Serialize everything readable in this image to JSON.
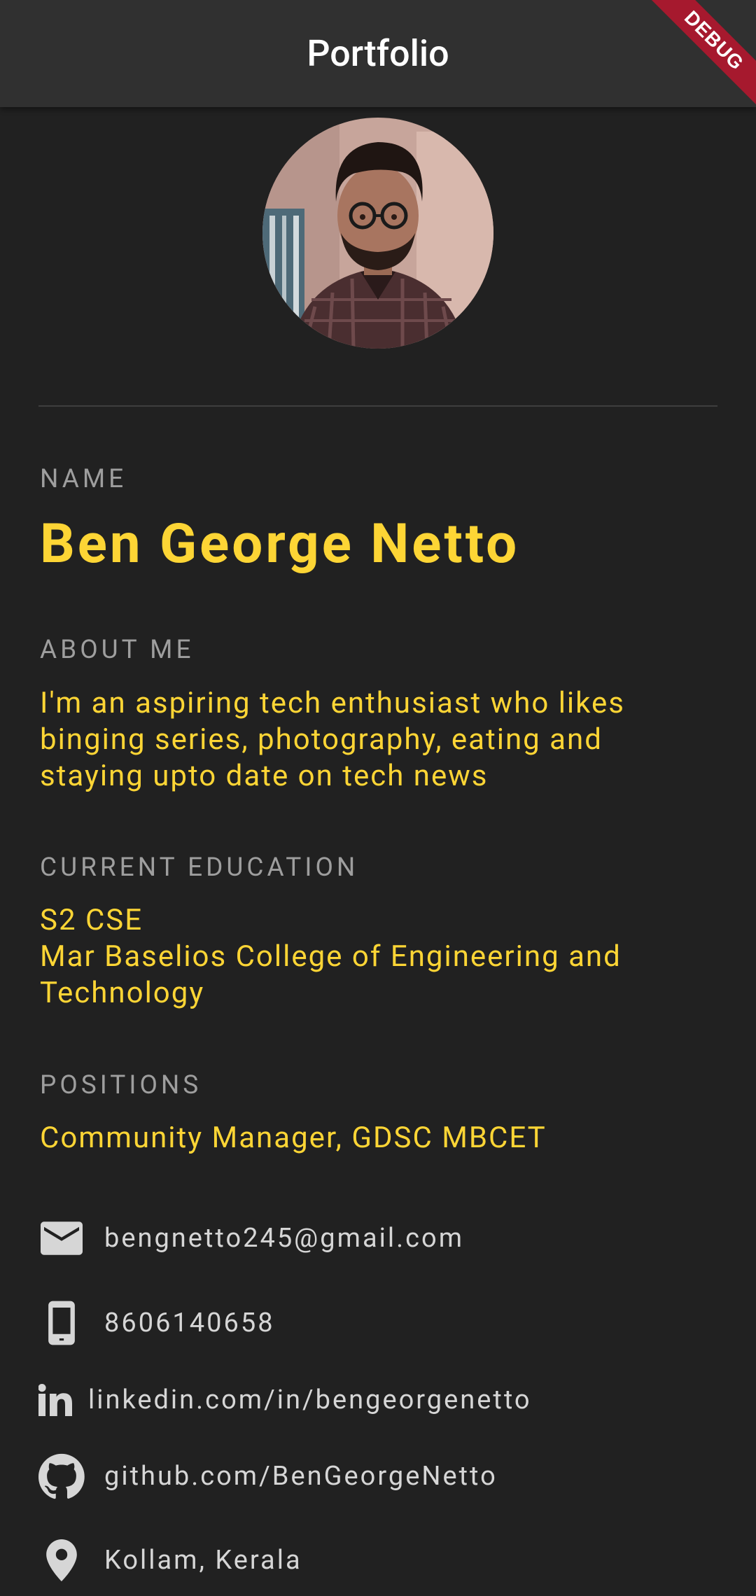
{
  "appbar": {
    "title": "Portfolio",
    "debug_label": "DEBUG"
  },
  "colors": {
    "background": "#212121",
    "appbar": "#303030",
    "accent": "#fdd535",
    "label": "#9e9e9e",
    "contact_text": "#d6d6d6",
    "debug": "#a6192e"
  },
  "profile": {
    "name_label": "NAME",
    "name": "Ben George Netto",
    "about_label": "ABOUT ME",
    "about_lines": [
      "I'm an aspiring tech enthusiast who likes",
      "binging series, photography, eating and",
      "staying upto date on tech news"
    ],
    "education_label": "CURRENT EDUCATION",
    "education_lines": [
      "S2 CSE",
      "Mar Baselios College of Engineering and",
      "Technology"
    ],
    "positions_label": "POSITIONS",
    "positions": "Community Manager, GDSC MBCET"
  },
  "contacts": [
    {
      "icon": "email-icon",
      "text": "bengnetto245@gmail.com"
    },
    {
      "icon": "phone-icon",
      "text": "8606140658"
    },
    {
      "icon": "linkedin-icon",
      "text": "linkedin.com/in/bengeorgenetto"
    },
    {
      "icon": "github-icon",
      "text": "github.com/BenGeorgeNetto"
    },
    {
      "icon": "location-icon",
      "text": "Kollam, Kerala"
    }
  ]
}
